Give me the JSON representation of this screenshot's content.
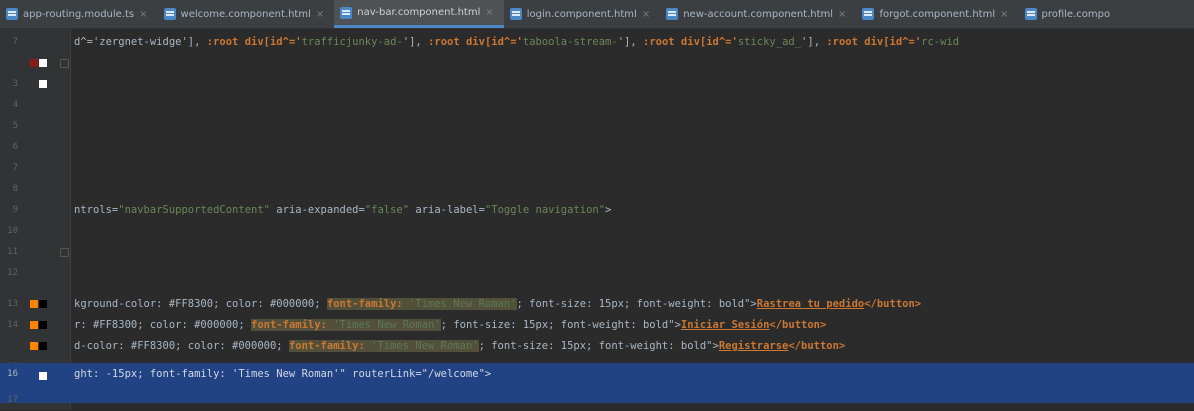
{
  "tabs": [
    {
      "label": "app-routing.module.ts",
      "active": false
    },
    {
      "label": "welcome.component.html",
      "active": false
    },
    {
      "label": "nav-bar.component.html",
      "active": true
    },
    {
      "label": "login.component.html",
      "active": false
    },
    {
      "label": "new-account.component.html",
      "active": false
    },
    {
      "label": "forgot.component.html",
      "active": false
    },
    {
      "label": "profile.compo",
      "active": false
    }
  ],
  "colors": {
    "swatch_red": "#8b1a1a",
    "swatch_white": "#ffffff",
    "swatch_orange": "#ff8300",
    "swatch_black": "#000000",
    "selection": "#214283"
  },
  "code": {
    "l1": {
      "a": "d^='zergnet-widge'], ",
      "b": ":root div[id^='",
      "c": "taboola-stream-",
      "d": "'], ",
      "e": ":root div[id^='",
      "f": "sticky_ad_",
      "g": "'], ",
      "h": ":root div[id^='",
      "i": "rc-wid"
    },
    "l1_mid": "trafficjunky-ad-",
    "l1_kw": ":root div[id^='",
    "l8": {
      "a": "ntrols=",
      "b": "\"navbarSupportedContent\"",
      "c": " aria-expanded=",
      "d": "\"false\"",
      "e": " aria-label=",
      "f": "\"Toggle navigation\"",
      "g": ">"
    },
    "l12": {
      "a": "kground-color: #FF8300; color: #000000; ",
      "b": "font-family:",
      "c": " 'Times New Roman'",
      "d": "; font-size: 15px; font-weight: bold\">",
      "e": "Rastrea tu pedido",
      "f": "</button>"
    },
    "l13": {
      "a": "r: #FF8300; color: #000000; ",
      "b": "font-family:",
      "c": " 'Times New Roman'",
      "d": "; font-size: 15px; font-weight: bold\">",
      "e": "Iniciar Sesión",
      "f": "</button>"
    },
    "l14": {
      "a": "d-color: #FF8300; color: #000000; ",
      "b": "font-family:",
      "c": " 'Times New Roman'",
      "d": "; font-size: 15px; font-weight: bold\">",
      "e": "Registrarse",
      "f": "</button>"
    },
    "l16": {
      "a": "ght: -15px; font-family: 'Times New Roman'\" routerLink=\"/welcome\">"
    }
  },
  "line_numbers": [
    "7",
    "",
    "3",
    "4",
    "5",
    "6",
    "7",
    "8",
    "9",
    "10",
    "11",
    "12",
    "13",
    "14",
    "",
    "16",
    "17"
  ]
}
